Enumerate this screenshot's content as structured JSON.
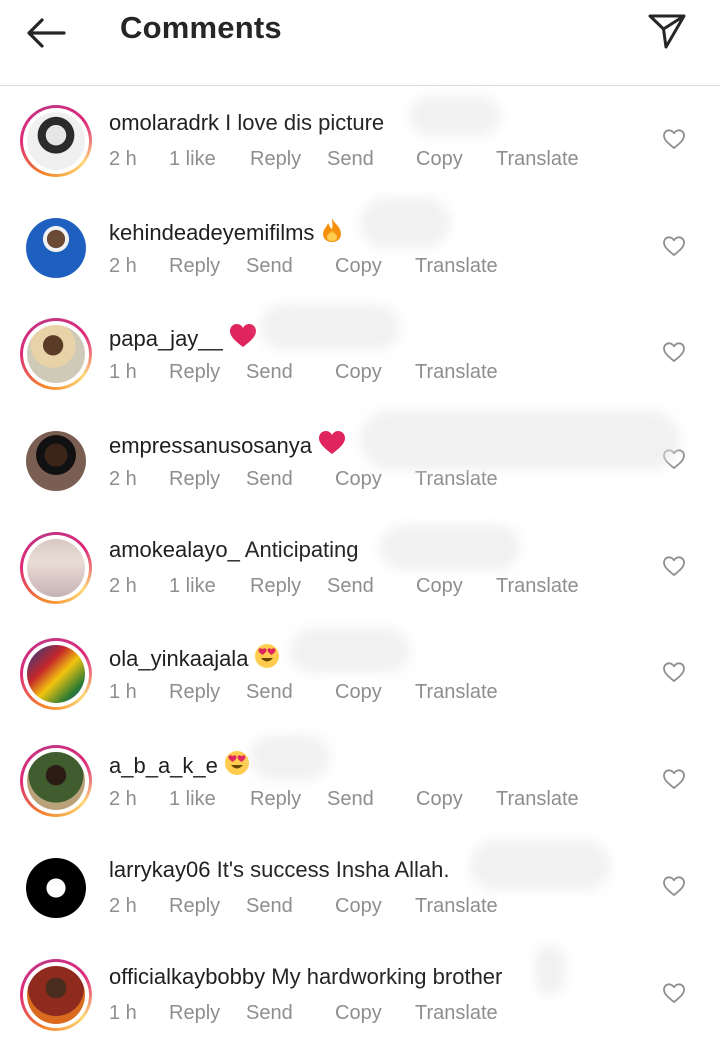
{
  "header": {
    "title": "Comments",
    "back_icon": "back-arrow-icon",
    "share_icon": "paper-plane-icon"
  },
  "comments": [
    {
      "username": "omolaradrk",
      "text": "I love dis picture",
      "emoji": "",
      "time": "2 h",
      "likes": "1 like",
      "reply": "Reply",
      "send": "Send",
      "copy": "Copy",
      "translate": "Translate"
    },
    {
      "username": "kehindeadeyemifilms",
      "text": "",
      "emoji": "fire",
      "time": "2 h",
      "likes": "",
      "reply": "Reply",
      "send": "Send",
      "copy": "Copy",
      "translate": "Translate"
    },
    {
      "username": "papa_jay__",
      "text": "",
      "emoji": "heart",
      "time": "1 h",
      "likes": "",
      "reply": "Reply",
      "send": "Send",
      "copy": "Copy",
      "translate": "Translate"
    },
    {
      "username": "empressanusosanya",
      "text": "",
      "emoji": "heart",
      "time": "2 h",
      "likes": "",
      "reply": "Reply",
      "send": "Send",
      "copy": "Copy",
      "translate": "Translate"
    },
    {
      "username": "amokealayo_",
      "text": "Anticipating",
      "emoji": "",
      "time": "2 h",
      "likes": "1 like",
      "reply": "Reply",
      "send": "Send",
      "copy": "Copy",
      "translate": "Translate"
    },
    {
      "username": "ola_yinkaajala",
      "text": "",
      "emoji": "heart-eyes",
      "time": "1 h",
      "likes": "",
      "reply": "Reply",
      "send": "Send",
      "copy": "Copy",
      "translate": "Translate"
    },
    {
      "username": "a_b_a_k_e",
      "text": "",
      "emoji": "heart-eyes",
      "time": "2 h",
      "likes": "1 like",
      "reply": "Reply",
      "send": "Send",
      "copy": "Copy",
      "translate": "Translate"
    },
    {
      "username": "larrykay06",
      "text": "It's success Insha Allah.",
      "emoji": "",
      "time": "2 h",
      "likes": "",
      "reply": "Reply",
      "send": "Send",
      "copy": "Copy",
      "translate": "Translate"
    },
    {
      "username": "officialkaybobby",
      "text": "My hardworking brother",
      "emoji": "",
      "time": "1 h",
      "likes": "",
      "reply": "Reply",
      "send": "Send",
      "copy": "Copy",
      "translate": "Translate"
    }
  ],
  "colors": {
    "text": "#262626",
    "meta": "#8e8e8e",
    "divider": "#dbdbdb",
    "heart_red": "#e0245e",
    "fire_orange": "#f4900c"
  }
}
